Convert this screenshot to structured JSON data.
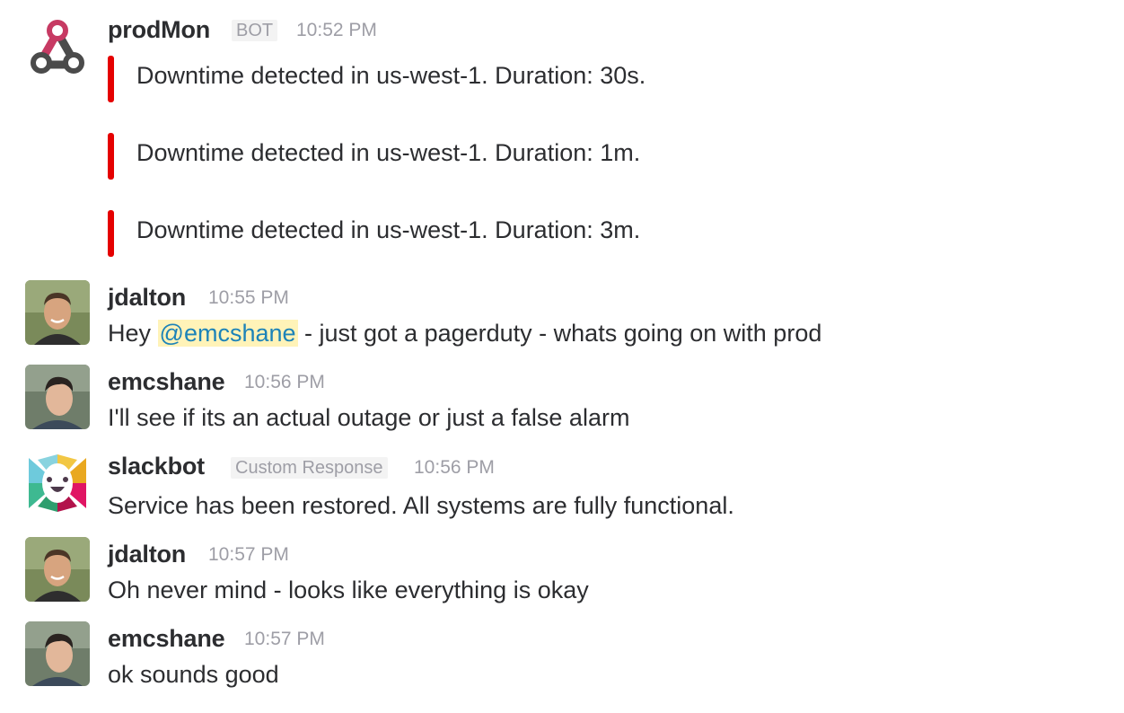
{
  "messages": [
    {
      "user": "prodMon",
      "tag": "BOT",
      "time": "10:52 PM",
      "attachments": [
        "Downtime detected in us-west-1.  Duration: 30s.",
        "Downtime detected in us-west-1.  Duration: 1m.",
        "Downtime detected in us-west-1.  Duration: 3m."
      ],
      "attachment_color": "#e50000"
    },
    {
      "user": "jdalton",
      "time": "10:55 PM",
      "text_before": "Hey ",
      "mention": "@emcshane",
      "text_after": " - just got a pagerduty - whats going on with prod"
    },
    {
      "user": "emcshane",
      "time": "10:56 PM",
      "text": "I'll see if its an actual outage or just a false alarm"
    },
    {
      "user": "slackbot",
      "tag": "Custom Response",
      "time": "10:56 PM",
      "text": "Service has been restored.  All systems are fully functional."
    },
    {
      "user": "jdalton",
      "time": "10:57 PM",
      "text": "Oh never mind - looks like everything is okay"
    },
    {
      "user": "emcshane",
      "time": "10:57 PM",
      "text": "ok sounds good"
    }
  ],
  "icons": {
    "prodmon_avatar": "webhook-icon",
    "slackbot_avatar": "slackbot-icon",
    "user_avatar": "person-photo"
  },
  "colors": {
    "mention_bg": "#fff3b8",
    "mention_text": "#1c83b8",
    "timestamp": "#9e9ea6"
  }
}
